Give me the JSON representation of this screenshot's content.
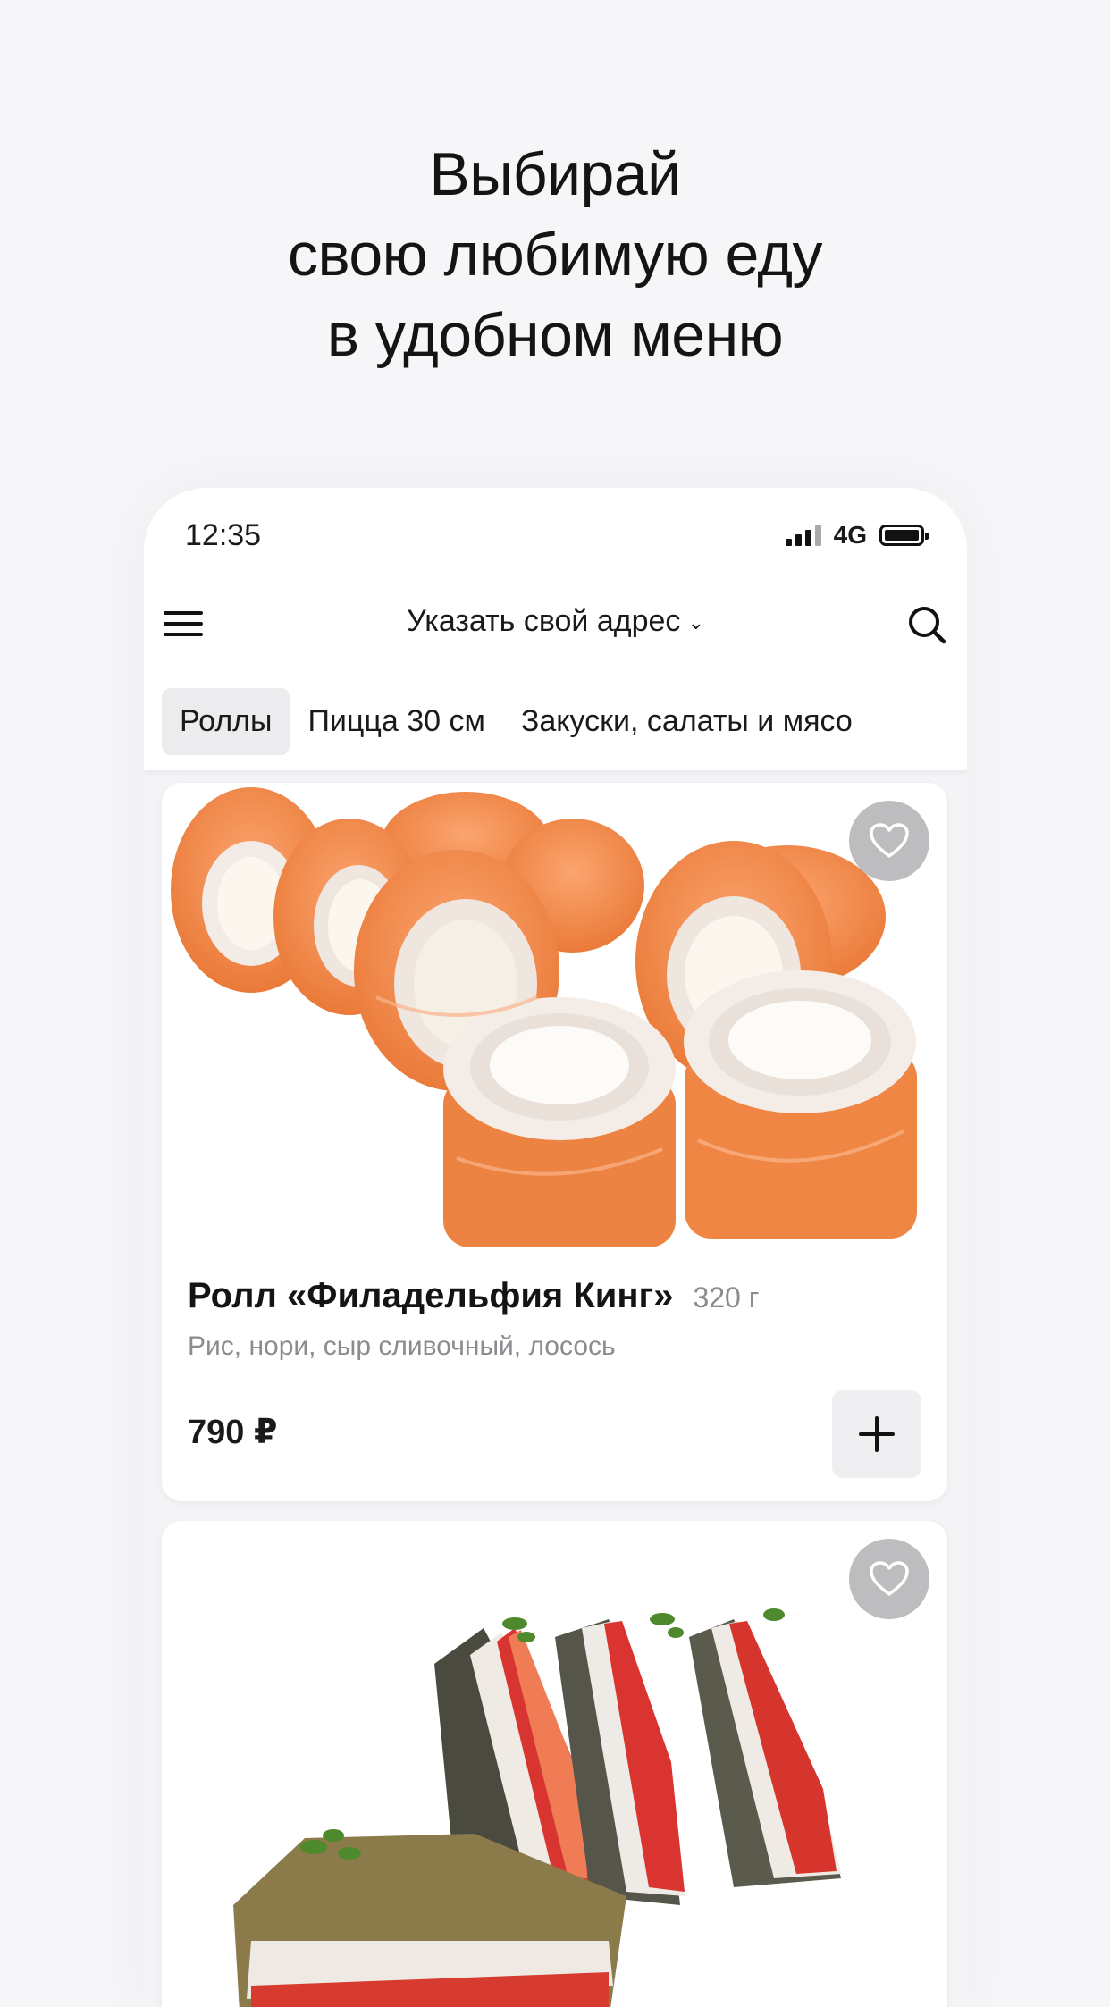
{
  "headline": {
    "line1": "Выбирай",
    "line2": "свою любимую еду",
    "line3": "в удобном меню"
  },
  "status_bar": {
    "time": "12:35",
    "network": "4G"
  },
  "header": {
    "address_label": "Указать свой адрес",
    "menu_icon": "hamburger-menu-icon",
    "search_icon": "search-icon"
  },
  "tabs": [
    {
      "label": "Роллы",
      "active": true
    },
    {
      "label": "Пицца 30 см",
      "active": false
    },
    {
      "label": "Закуски, салаты и мясо",
      "active": false
    }
  ],
  "products": [
    {
      "title": "Ролл «Филадельфия Кинг»",
      "weight": "320 г",
      "description": "Рис, нори, сыр сливочный, лосось",
      "price": "790 ₽",
      "image": "salmon-philadelphia-rolls-image"
    },
    {
      "image": "tempura-sandwich-rolls-image"
    }
  ],
  "colors": {
    "background": "#f6f5f8",
    "card": "#ffffff",
    "heart_button": "#bdbdc0",
    "salmon": "#f08a4b",
    "tab_active": "#ececef"
  }
}
